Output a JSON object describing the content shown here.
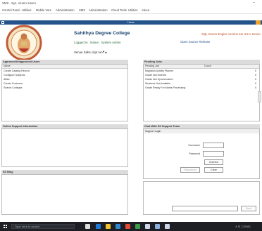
{
  "window": {
    "title": "SMS - Sys. Alumni Users",
    "minimize_glyph": "–"
  },
  "menu": [
    "Control Panel",
    "Utilities",
    "Mobile Vars",
    "Administration",
    "SMS",
    "Administration",
    "Cloud Tools",
    "Utilities",
    "About"
  ],
  "toolbar": {
    "home_label": "Home"
  },
  "header": {
    "college_name": "Sahithya Degree College",
    "logged_in": "Logged In :   Name : System Admin",
    "version_label": "Venue Sahs cript Ion : ∎",
    "version_caret": "▾",
    "notice": "SQL Server Engine version are 3.8.1 Server",
    "notice_link": "Open Source Release"
  },
  "panels": {
    "left_top": {
      "title": "Approved/Unapproved Users",
      "column": "Name",
      "rows": [
        "Create Catalog Record",
        "Configure Subjects",
        "Allies",
        "Create Customer",
        "Search Colleges"
      ]
    },
    "right_top": {
      "title": "Pending Jobs",
      "columns": [
        "Pending Job",
        "Count"
      ],
      "rows": [
        [
          "Migration Activity Planner",
          "0"
        ],
        [
          "Grade Not Entered",
          "0"
        ],
        [
          "Grade Not Synchronized",
          "0"
        ],
        [
          "Students Not Available",
          "0"
        ],
        [
          "Grade Ready For Marks Processing",
          "0"
        ]
      ]
    },
    "online": {
      "title": "Online Support Information"
    },
    "chat": {
      "title": "Chat With SS Support Team",
      "form_title": "Support Login",
      "username_label": "Username",
      "password_label": "Password",
      "connect_label": "Connect",
      "disconnect_label": "Disconnect",
      "clear_label": "Clear",
      "send_label": "Send"
    },
    "log": {
      "title": "SS Blog"
    }
  },
  "taskbar": {
    "search_placeholder": "Type here to search",
    "clock": "∧ ⊡ ◻ ENG"
  },
  "colors": {
    "bar": "#23538a",
    "accent": "#f1a22a",
    "notice": "#c04a1b"
  }
}
